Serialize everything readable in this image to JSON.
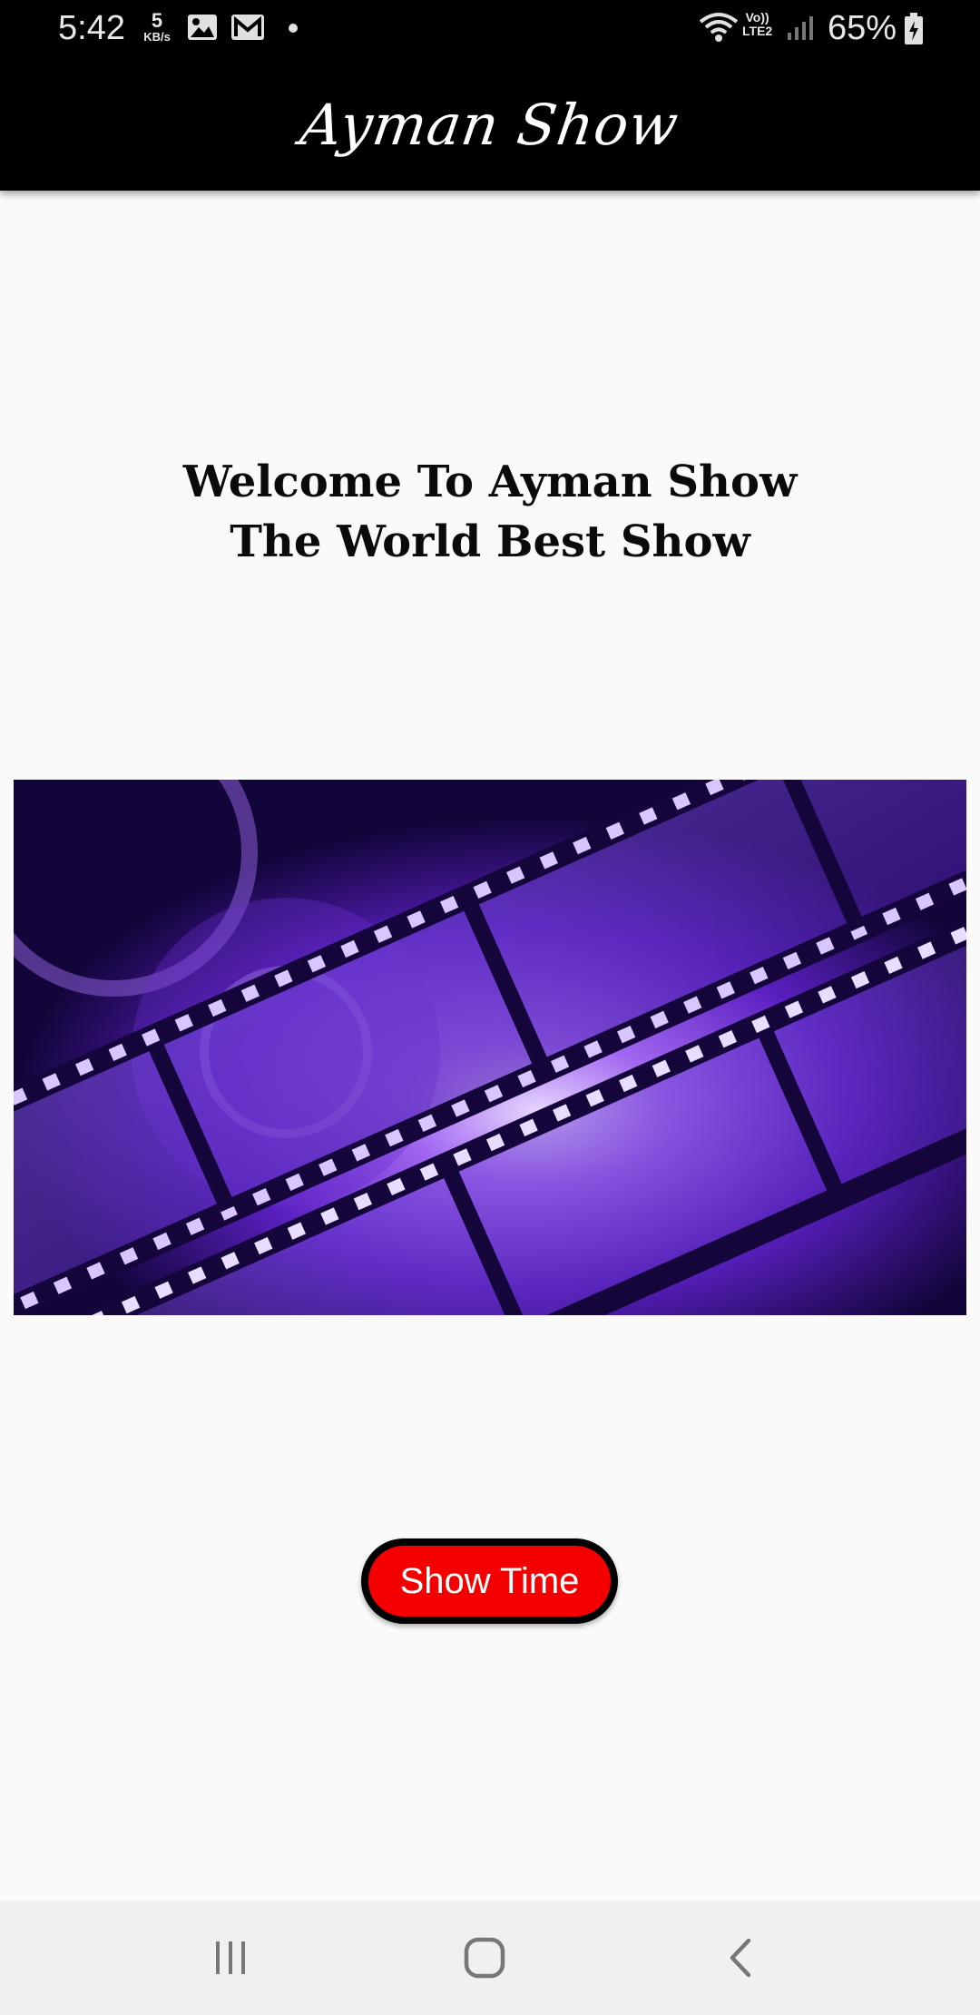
{
  "status_bar": {
    "time": "5:42",
    "net_speed_value": "5",
    "net_speed_unit": "KB/s",
    "notification_icons": [
      "image-icon",
      "gmail-icon",
      "dot-icon"
    ],
    "lte_line1": "Vo))",
    "lte_line2": "LTE2",
    "battery_percent": "65%"
  },
  "app_bar": {
    "title": "Ayman Show"
  },
  "main": {
    "welcome_line1": "Welcome To Ayman Show",
    "welcome_line2": "The World Best Show",
    "hero_image": "film-reel-purple",
    "button_label": "Show Time"
  },
  "colors": {
    "app_bar_bg": "#000000",
    "button_bg": "#f50000",
    "page_bg": "#fafafa"
  },
  "nav_bar": {
    "items": [
      "recents-icon",
      "home-icon",
      "back-icon"
    ]
  }
}
